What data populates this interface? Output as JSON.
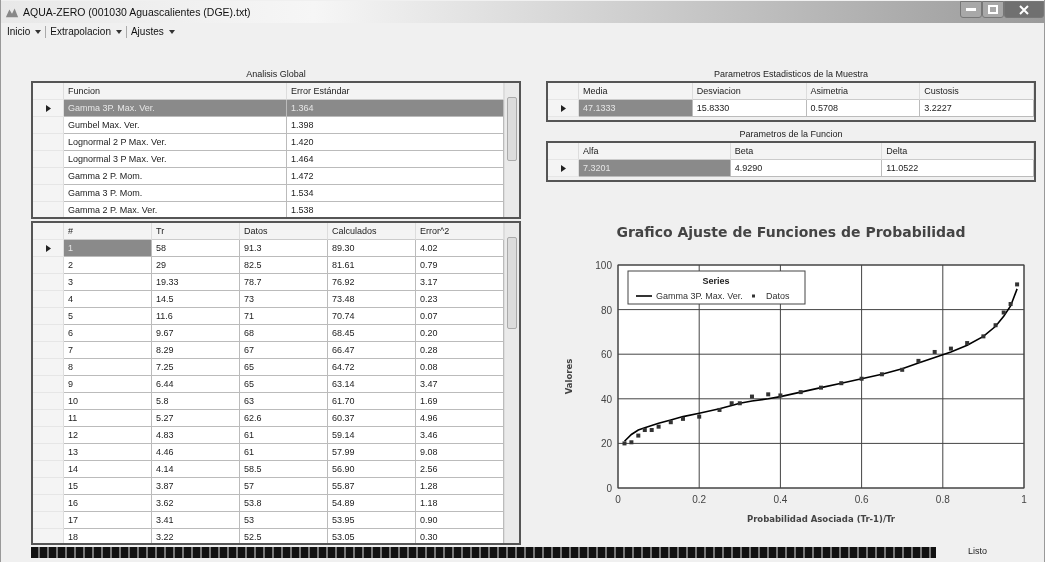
{
  "window": {
    "title": "AQUA-ZERO (001030 Aguascalientes (DGE).txt)"
  },
  "menu": [
    {
      "label": "Inicio"
    },
    {
      "label": "Extrapolacion"
    },
    {
      "label": "Ajustes"
    }
  ],
  "global_table": {
    "title": "Analisis Global",
    "full_row_select": true,
    "columns": [
      "Funcion",
      "Error Estándar"
    ],
    "rows": [
      {
        "cells": [
          "Gamma 3P. Max. Ver.",
          "1.364"
        ],
        "selected": true
      },
      {
        "cells": [
          "Gumbel Max. Ver.",
          "1.398"
        ],
        "selected": false
      },
      {
        "cells": [
          "Lognormal 2 P Max. Ver.",
          "1.420"
        ],
        "selected": false
      },
      {
        "cells": [
          "Lognormal 3 P Max. Ver.",
          "1.464"
        ],
        "selected": false
      },
      {
        "cells": [
          "Gamma 2 P. Mom.",
          "1.472"
        ],
        "selected": false
      },
      {
        "cells": [
          "Gamma 3 P. Mom.",
          "1.534"
        ],
        "selected": false
      },
      {
        "cells": [
          "Gamma 2 P. Max. Ver.",
          "1.538"
        ],
        "selected": false
      }
    ]
  },
  "data_table": {
    "full_row_select": false,
    "columns": [
      "#",
      "Tr",
      "Datos",
      "Calculados",
      "Error^2"
    ],
    "rows": [
      {
        "cells": [
          "1",
          "58",
          "91.3",
          "89.30",
          "4.02"
        ],
        "selected": true
      },
      {
        "cells": [
          "2",
          "29",
          "82.5",
          "81.61",
          "0.79"
        ],
        "selected": false
      },
      {
        "cells": [
          "3",
          "19.33",
          "78.7",
          "76.92",
          "3.17"
        ],
        "selected": false
      },
      {
        "cells": [
          "4",
          "14.5",
          "73",
          "73.48",
          "0.23"
        ],
        "selected": false
      },
      {
        "cells": [
          "5",
          "11.6",
          "71",
          "70.74",
          "0.07"
        ],
        "selected": false
      },
      {
        "cells": [
          "6",
          "9.67",
          "68",
          "68.45",
          "0.20"
        ],
        "selected": false
      },
      {
        "cells": [
          "7",
          "8.29",
          "67",
          "66.47",
          "0.28"
        ],
        "selected": false
      },
      {
        "cells": [
          "8",
          "7.25",
          "65",
          "64.72",
          "0.08"
        ],
        "selected": false
      },
      {
        "cells": [
          "9",
          "6.44",
          "65",
          "63.14",
          "3.47"
        ],
        "selected": false
      },
      {
        "cells": [
          "10",
          "5.8",
          "63",
          "61.70",
          "1.69"
        ],
        "selected": false
      },
      {
        "cells": [
          "11",
          "5.27",
          "62.6",
          "60.37",
          "4.96"
        ],
        "selected": false
      },
      {
        "cells": [
          "12",
          "4.83",
          "61",
          "59.14",
          "3.46"
        ],
        "selected": false
      },
      {
        "cells": [
          "13",
          "4.46",
          "61",
          "57.99",
          "9.08"
        ],
        "selected": false
      },
      {
        "cells": [
          "14",
          "4.14",
          "58.5",
          "56.90",
          "2.56"
        ],
        "selected": false
      },
      {
        "cells": [
          "15",
          "3.87",
          "57",
          "55.87",
          "1.28"
        ],
        "selected": false
      },
      {
        "cells": [
          "16",
          "3.62",
          "53.8",
          "54.89",
          "1.18"
        ],
        "selected": false
      },
      {
        "cells": [
          "17",
          "3.41",
          "53",
          "53.95",
          "0.90"
        ],
        "selected": false
      },
      {
        "cells": [
          "18",
          "3.22",
          "52.5",
          "53.05",
          "0.30"
        ],
        "selected": false
      }
    ]
  },
  "stats_table": {
    "title": "Parametros Estadisticos de la Muestra",
    "full_row_select": false,
    "columns": [
      "Media",
      "Desviacion",
      "Asimetria",
      "Custosis"
    ],
    "rows": [
      {
        "cells": [
          "47.1333",
          "15.8330",
          "0.5708",
          "3.2227"
        ],
        "selected": true
      }
    ]
  },
  "params_table": {
    "title": "Parametros de la Funcion",
    "full_row_select": false,
    "columns": [
      "Alfa",
      "Beta",
      "Delta"
    ],
    "rows": [
      {
        "cells": [
          "7.3201",
          "4.9290",
          "11.0522"
        ],
        "selected": true
      }
    ]
  },
  "chart": {
    "chart_data": {
      "type": "line",
      "legend": {
        "title": "Series"
      },
      "title": "Grafico Ajuste de Funciones de Probabilidad",
      "xlabel": "Probabilidad Asociada (Tr-1)/Tr",
      "ylabel": "Valores",
      "x": [
        0.016,
        0.033,
        0.05,
        0.066,
        0.083,
        0.1,
        0.13,
        0.16,
        0.2,
        0.25,
        0.28,
        0.3,
        0.33,
        0.37,
        0.4,
        0.45,
        0.5,
        0.55,
        0.6,
        0.65,
        0.7,
        0.74,
        0.78,
        0.82,
        0.86,
        0.9,
        0.93,
        0.95,
        0.967,
        0.983
      ],
      "series": [
        {
          "name": "Gamma 3P. Max. Ver.",
          "type": "line",
          "color": "#000000",
          "values": [
            21,
            24,
            26,
            27,
            28,
            29,
            30.5,
            32,
            33.5,
            35.5,
            37,
            38,
            39,
            40,
            41,
            43,
            45,
            47,
            49,
            51,
            53.5,
            56,
            58.5,
            61,
            64,
            68,
            72.5,
            77,
            81.6,
            89.3
          ]
        },
        {
          "name": "Datos",
          "type": "scatter",
          "color": "#333333",
          "values": [
            20,
            20.5,
            23.5,
            26,
            26,
            27.5,
            29.5,
            31,
            32,
            35,
            38,
            38,
            41,
            42,
            41.5,
            43,
            45,
            47,
            49,
            51,
            53,
            57,
            61,
            62.5,
            65,
            68,
            73,
            78.7,
            82.5,
            91.3
          ]
        }
      ],
      "grid": true,
      "xlim": [
        0,
        1
      ],
      "ylim": [
        0,
        100
      ],
      "xticks": [
        0,
        0.2,
        0.4,
        0.6,
        0.8,
        1
      ],
      "yticks": [
        0,
        20,
        40,
        60,
        80,
        100
      ]
    }
  },
  "progress": {
    "level": 1,
    "status": "Listo"
  }
}
